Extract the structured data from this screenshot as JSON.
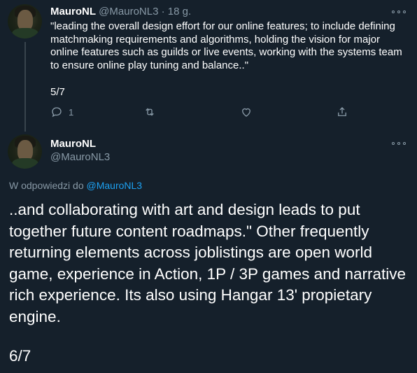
{
  "tweet1": {
    "name": "MauroNL",
    "handle": "@MauroNL3",
    "separator": "·",
    "time": "18 g.",
    "text": "\"leading the overall design effort for our online features; to include defining matchmaking requirements and algorithms, holding the vision for major online features such as guilds or live events, working with the systems team to ensure online play tuning and balance..\"",
    "counter": "5/7",
    "reply_count": "1",
    "icons": [
      "reply-icon",
      "retweet-icon",
      "like-icon",
      "share-icon",
      "more-icon"
    ]
  },
  "tweet2": {
    "name": "MauroNL",
    "handle": "@MauroNL3",
    "reply_prefix": "W odpowiedzi do",
    "reply_mention": "@MauroNL3",
    "text": "..and collaborating with art and design leads to put together future content roadmaps.\" Other frequently returning elements across joblistings are open world game, experience in Action, 1P / 3P games and narrative rich experience. Its also using Hangar 13' propietary engine.",
    "counter": "6/7",
    "icons": [
      "more-icon"
    ]
  },
  "colors": {
    "background": "#15202b",
    "muted": "#8899a6",
    "link": "#1da1f2",
    "thread_line": "#38444d"
  }
}
